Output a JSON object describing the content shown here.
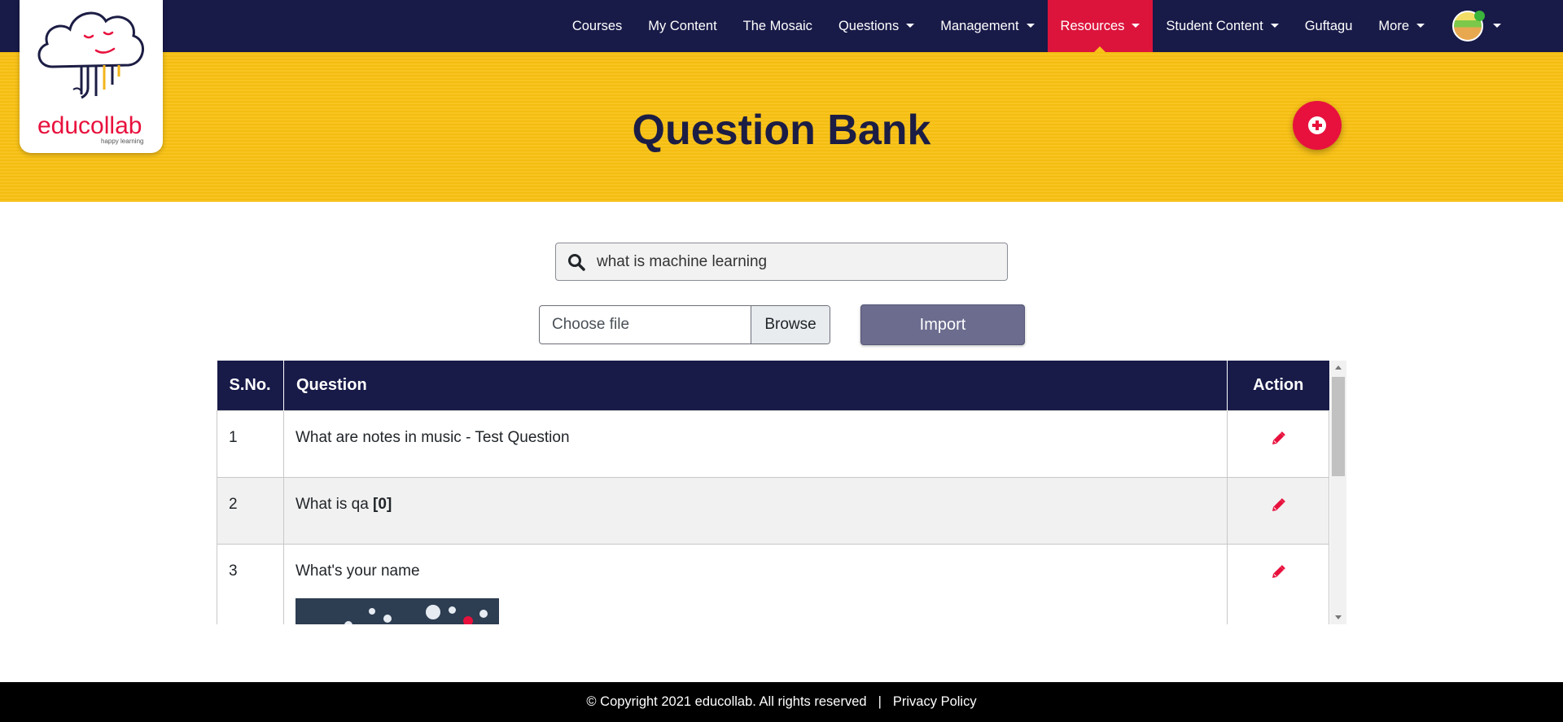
{
  "brand": {
    "logo_text": "educollab",
    "logo_tagline": "happy learning"
  },
  "nav": {
    "items": [
      {
        "label": "Courses"
      },
      {
        "label": "My Content"
      },
      {
        "label": "The Mosaic"
      },
      {
        "label": "Questions"
      },
      {
        "label": "Management"
      },
      {
        "label": "Resources"
      },
      {
        "label": "Student Content"
      },
      {
        "label": "Guftagu"
      },
      {
        "label": "More"
      }
    ],
    "active": "Resources",
    "profile_icon": "avatar-icon"
  },
  "page": {
    "title": "Question Bank",
    "add_icon": "plus-circle-icon"
  },
  "search": {
    "value": "what is machine learning",
    "icon": "search-icon"
  },
  "file_upload": {
    "placeholder": "Choose file",
    "browse_label": "Browse",
    "import_label": "Import"
  },
  "table": {
    "headers": {
      "sno": "S.No.",
      "question": "Question",
      "action": "Action"
    },
    "rows": [
      {
        "sno": "1",
        "question": "What are notes in music - Test Question",
        "suffix": "",
        "has_image": false
      },
      {
        "sno": "2",
        "question": "What is qa",
        "suffix": "[0]",
        "has_image": false
      },
      {
        "sno": "3",
        "question": "What's your name",
        "suffix": "",
        "has_image": true
      }
    ],
    "action_icon": "pencil-icon"
  },
  "footer": {
    "copyright": "© Copyright 2021 educollab. All rights reserved",
    "separator": "|",
    "privacy_link": "Privacy Policy"
  },
  "colors": {
    "navbar": "#181a48",
    "banner": "#f8c012",
    "accent": "#dc143c",
    "footer": "#000000"
  }
}
